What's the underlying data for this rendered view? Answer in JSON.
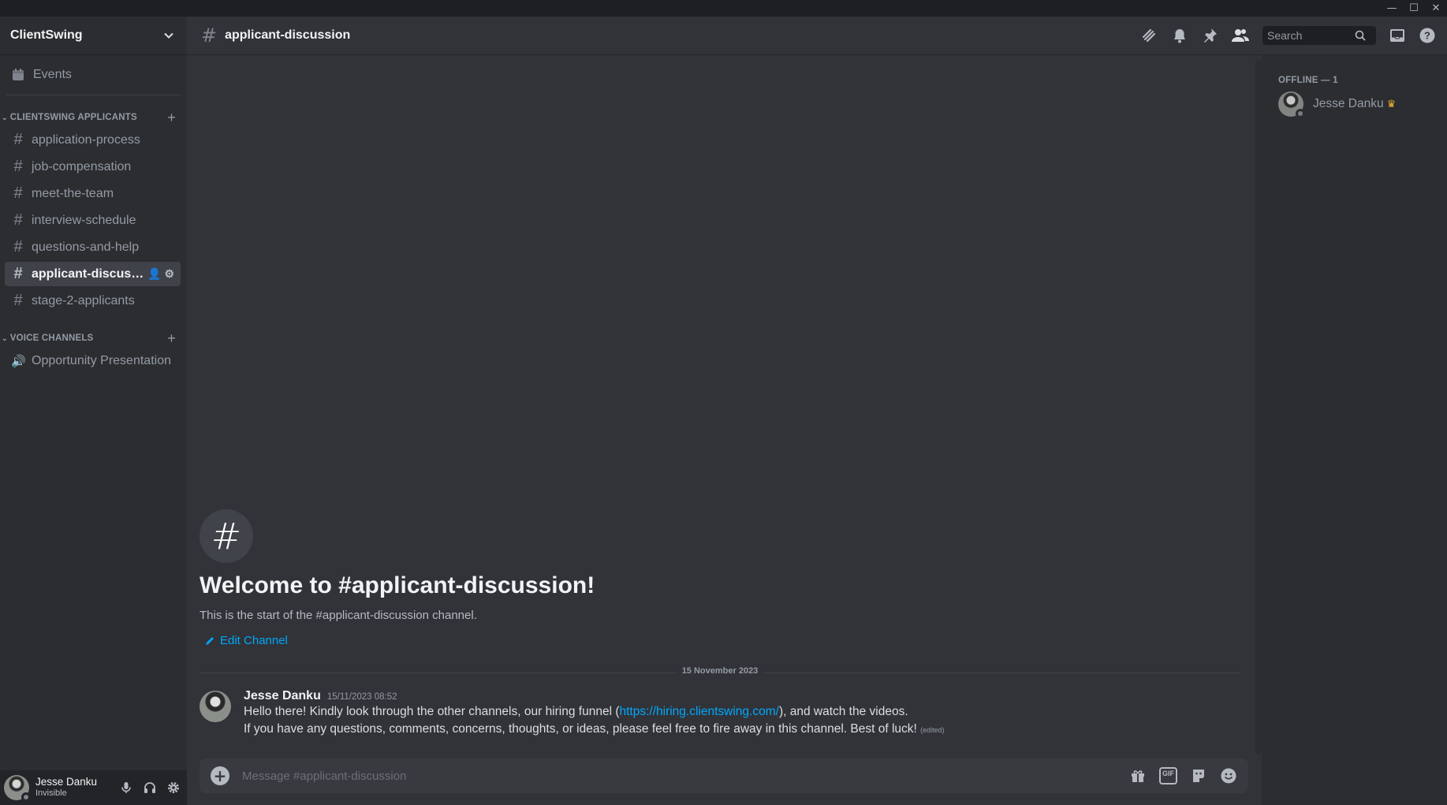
{
  "window": {
    "minimize": "—",
    "maximize": "☐",
    "close": "✕"
  },
  "server": {
    "name": "ClientSwing"
  },
  "sidebar": {
    "events_label": "Events",
    "categories": [
      {
        "name": "CLIENTSWING APPLICANTS"
      },
      {
        "name": "VOICE CHANNELS"
      }
    ],
    "channels": [
      {
        "label": "application-process"
      },
      {
        "label": "job-compensation"
      },
      {
        "label": "meet-the-team"
      },
      {
        "label": "interview-schedule"
      },
      {
        "label": "questions-and-help"
      },
      {
        "label": "applicant-discussion",
        "active": true
      },
      {
        "label": "stage-2-applicants"
      }
    ],
    "voice_channels": [
      {
        "label": "Opportunity Presentation"
      }
    ]
  },
  "user": {
    "name": "Jesse Danku",
    "status": "Invisible"
  },
  "header": {
    "channel_name": "applicant-discussion",
    "search_placeholder": "Search"
  },
  "welcome": {
    "title": "Welcome to #applicant-discussion!",
    "subtitle": "This is the start of the #applicant-discussion channel.",
    "edit_label": "Edit Channel"
  },
  "divider_date": "15 November 2023",
  "message": {
    "author": "Jesse Danku",
    "timestamp": "15/11/2023 08:52",
    "line1_before": "Hello there! Kindly look through the other channels, our hiring funnel (",
    "link": "https://hiring.clientswing.com/",
    "line1_after": "), and watch the videos.",
    "line2": "If you have any questions, comments, concerns, thoughts, or ideas, please feel free to fire away in this channel. Best of luck!",
    "edited": "(edited)"
  },
  "composer": {
    "placeholder": "Message #applicant-discussion",
    "gif_label": "GIF"
  },
  "members": {
    "heading": "OFFLINE — 1",
    "list": [
      {
        "name": "Jesse Danku",
        "owner": true
      }
    ]
  },
  "colors": {
    "background": "#313338",
    "sidebar": "#2b2d31",
    "link": "#00a8fc",
    "crown": "#f0b232"
  }
}
